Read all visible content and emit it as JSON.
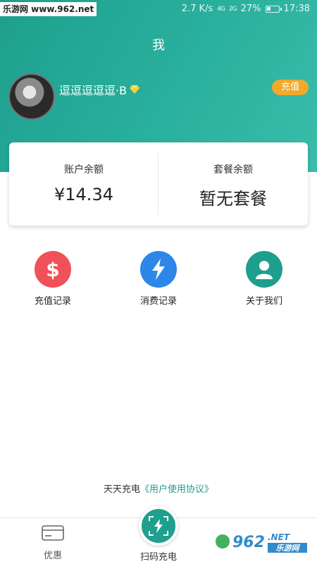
{
  "status_bar": {
    "watermark": "乐游网 www.962.net",
    "speed": "2.7 K/s",
    "signal1": "4G",
    "signal2": "2G",
    "battery": "27%",
    "time": "17:38"
  },
  "header": {
    "title": "我"
  },
  "user": {
    "name": "逗逗逗逗逗·B",
    "recharge_label": "充值"
  },
  "balance": {
    "account_label": "账户余额",
    "account_value": "¥14.34",
    "package_label": "套餐余额",
    "package_value": "暂无套餐"
  },
  "actions": [
    {
      "label": "充值记录",
      "icon": "dollar-icon",
      "color": "#f05058"
    },
    {
      "label": "消费记录",
      "icon": "lightning-icon",
      "color": "#2e86e8"
    },
    {
      "label": "关于我们",
      "icon": "person-icon",
      "color": "#1e9f8e"
    }
  ],
  "agreement": {
    "prefix": "天天充电",
    "link": "《用户使用协议》"
  },
  "bottom_nav": {
    "discount_label": "优惠",
    "scan_label": "扫码充电"
  },
  "colors": {
    "brand": "#1e9f8e",
    "recharge": "#f2a92c"
  }
}
